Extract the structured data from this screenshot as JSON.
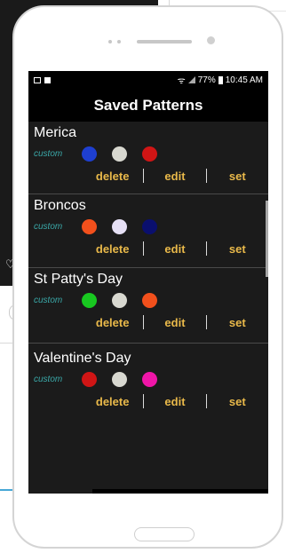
{
  "statusbar": {
    "battery": "77%",
    "time": "10:45 AM"
  },
  "title": "Saved Patterns",
  "custom_label": "custom",
  "actions": {
    "delete": "delete",
    "edit": "edit",
    "set": "set"
  },
  "patterns": [
    {
      "name": "Merica",
      "colors": [
        "#1e3fd0",
        "#d8d8d0",
        "#d01515"
      ]
    },
    {
      "name": "Broncos",
      "colors": [
        "#f2501c",
        "#e6e0f5",
        "#0a0f6e"
      ]
    },
    {
      "name": "St Patty's Day",
      "colors": [
        "#18c820",
        "#d8d8d0",
        "#f2501c"
      ]
    },
    {
      "name": "Valentine's Day",
      "colors": [
        "#d01515",
        "#d8d8d0",
        "#f015a8"
      ]
    }
  ]
}
